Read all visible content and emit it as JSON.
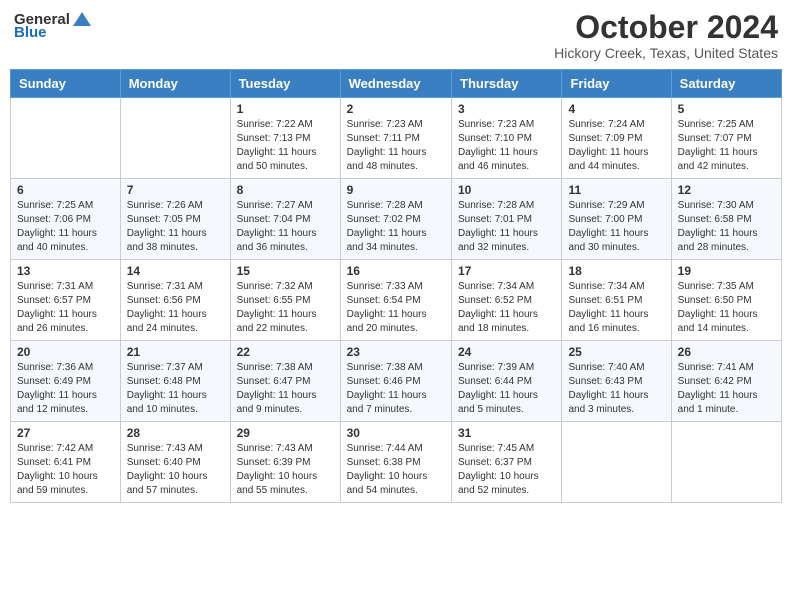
{
  "header": {
    "logo_general": "General",
    "logo_blue": "Blue",
    "month": "October 2024",
    "location": "Hickory Creek, Texas, United States"
  },
  "weekdays": [
    "Sunday",
    "Monday",
    "Tuesday",
    "Wednesday",
    "Thursday",
    "Friday",
    "Saturday"
  ],
  "weeks": [
    [
      {
        "day": "",
        "info": ""
      },
      {
        "day": "",
        "info": ""
      },
      {
        "day": "1",
        "info": "Sunrise: 7:22 AM\nSunset: 7:13 PM\nDaylight: 11 hours and 50 minutes."
      },
      {
        "day": "2",
        "info": "Sunrise: 7:23 AM\nSunset: 7:11 PM\nDaylight: 11 hours and 48 minutes."
      },
      {
        "day": "3",
        "info": "Sunrise: 7:23 AM\nSunset: 7:10 PM\nDaylight: 11 hours and 46 minutes."
      },
      {
        "day": "4",
        "info": "Sunrise: 7:24 AM\nSunset: 7:09 PM\nDaylight: 11 hours and 44 minutes."
      },
      {
        "day": "5",
        "info": "Sunrise: 7:25 AM\nSunset: 7:07 PM\nDaylight: 11 hours and 42 minutes."
      }
    ],
    [
      {
        "day": "6",
        "info": "Sunrise: 7:25 AM\nSunset: 7:06 PM\nDaylight: 11 hours and 40 minutes."
      },
      {
        "day": "7",
        "info": "Sunrise: 7:26 AM\nSunset: 7:05 PM\nDaylight: 11 hours and 38 minutes."
      },
      {
        "day": "8",
        "info": "Sunrise: 7:27 AM\nSunset: 7:04 PM\nDaylight: 11 hours and 36 minutes."
      },
      {
        "day": "9",
        "info": "Sunrise: 7:28 AM\nSunset: 7:02 PM\nDaylight: 11 hours and 34 minutes."
      },
      {
        "day": "10",
        "info": "Sunrise: 7:28 AM\nSunset: 7:01 PM\nDaylight: 11 hours and 32 minutes."
      },
      {
        "day": "11",
        "info": "Sunrise: 7:29 AM\nSunset: 7:00 PM\nDaylight: 11 hours and 30 minutes."
      },
      {
        "day": "12",
        "info": "Sunrise: 7:30 AM\nSunset: 6:58 PM\nDaylight: 11 hours and 28 minutes."
      }
    ],
    [
      {
        "day": "13",
        "info": "Sunrise: 7:31 AM\nSunset: 6:57 PM\nDaylight: 11 hours and 26 minutes."
      },
      {
        "day": "14",
        "info": "Sunrise: 7:31 AM\nSunset: 6:56 PM\nDaylight: 11 hours and 24 minutes."
      },
      {
        "day": "15",
        "info": "Sunrise: 7:32 AM\nSunset: 6:55 PM\nDaylight: 11 hours and 22 minutes."
      },
      {
        "day": "16",
        "info": "Sunrise: 7:33 AM\nSunset: 6:54 PM\nDaylight: 11 hours and 20 minutes."
      },
      {
        "day": "17",
        "info": "Sunrise: 7:34 AM\nSunset: 6:52 PM\nDaylight: 11 hours and 18 minutes."
      },
      {
        "day": "18",
        "info": "Sunrise: 7:34 AM\nSunset: 6:51 PM\nDaylight: 11 hours and 16 minutes."
      },
      {
        "day": "19",
        "info": "Sunrise: 7:35 AM\nSunset: 6:50 PM\nDaylight: 11 hours and 14 minutes."
      }
    ],
    [
      {
        "day": "20",
        "info": "Sunrise: 7:36 AM\nSunset: 6:49 PM\nDaylight: 11 hours and 12 minutes."
      },
      {
        "day": "21",
        "info": "Sunrise: 7:37 AM\nSunset: 6:48 PM\nDaylight: 11 hours and 10 minutes."
      },
      {
        "day": "22",
        "info": "Sunrise: 7:38 AM\nSunset: 6:47 PM\nDaylight: 11 hours and 9 minutes."
      },
      {
        "day": "23",
        "info": "Sunrise: 7:38 AM\nSunset: 6:46 PM\nDaylight: 11 hours and 7 minutes."
      },
      {
        "day": "24",
        "info": "Sunrise: 7:39 AM\nSunset: 6:44 PM\nDaylight: 11 hours and 5 minutes."
      },
      {
        "day": "25",
        "info": "Sunrise: 7:40 AM\nSunset: 6:43 PM\nDaylight: 11 hours and 3 minutes."
      },
      {
        "day": "26",
        "info": "Sunrise: 7:41 AM\nSunset: 6:42 PM\nDaylight: 11 hours and 1 minute."
      }
    ],
    [
      {
        "day": "27",
        "info": "Sunrise: 7:42 AM\nSunset: 6:41 PM\nDaylight: 10 hours and 59 minutes."
      },
      {
        "day": "28",
        "info": "Sunrise: 7:43 AM\nSunset: 6:40 PM\nDaylight: 10 hours and 57 minutes."
      },
      {
        "day": "29",
        "info": "Sunrise: 7:43 AM\nSunset: 6:39 PM\nDaylight: 10 hours and 55 minutes."
      },
      {
        "day": "30",
        "info": "Sunrise: 7:44 AM\nSunset: 6:38 PM\nDaylight: 10 hours and 54 minutes."
      },
      {
        "day": "31",
        "info": "Sunrise: 7:45 AM\nSunset: 6:37 PM\nDaylight: 10 hours and 52 minutes."
      },
      {
        "day": "",
        "info": ""
      },
      {
        "day": "",
        "info": ""
      }
    ]
  ]
}
